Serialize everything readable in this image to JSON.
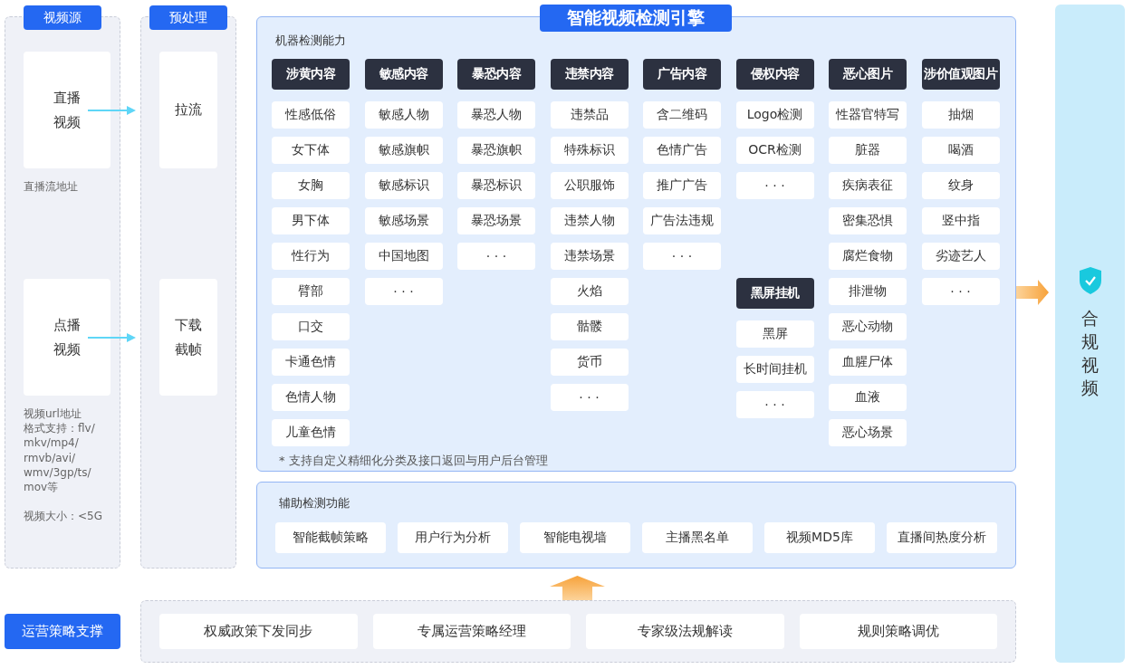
{
  "sources": {
    "title": "视频源",
    "cards": [
      {
        "label": "直播视频",
        "notes": [
          [
            "直播流地址"
          ]
        ]
      },
      {
        "label": "点播视频",
        "notes": [
          [
            "视频url地址",
            "格式支持：flv/",
            "mkv/mp4/",
            "rmvb/avi/",
            "wmv/3gp/ts/",
            "mov等"
          ],
          [
            "视频大小：<5G"
          ]
        ]
      }
    ]
  },
  "preprocess": {
    "title": "预处理",
    "cards": [
      {
        "label": "拉流"
      },
      {
        "label": "下载截帧"
      }
    ]
  },
  "engine": {
    "title": "智能视频检测引擎",
    "machine": {
      "title": "机器检测能力",
      "columns": [
        {
          "groups": [
            {
              "title": "涉黄内容",
              "items": [
                "性感低俗",
                "女下体",
                "女胸",
                "男下体",
                "性行为",
                "臂部",
                "口交",
                "卡通色情",
                "色情人物",
                "儿童色情"
              ]
            }
          ]
        },
        {
          "groups": [
            {
              "title": "敏感内容",
              "items": [
                "敏感人物",
                "敏感旗帜",
                "敏感标识",
                "敏感场景",
                "中国地图",
                "· · ·"
              ]
            }
          ]
        },
        {
          "groups": [
            {
              "title": "暴恐内容",
              "items": [
                "暴恐人物",
                "暴恐旗帜",
                "暴恐标识",
                "暴恐场景",
                "· · ·"
              ]
            }
          ]
        },
        {
          "groups": [
            {
              "title": "违禁内容",
              "items": [
                "违禁品",
                "特殊标识",
                "公职服饰",
                "违禁人物",
                "违禁场景",
                "火焰",
                "骷髅",
                "货币",
                "· · ·"
              ]
            }
          ]
        },
        {
          "groups": [
            {
              "title": "广告内容",
              "items": [
                "含二维码",
                "色情广告",
                "推广广告",
                "广告法违规",
                "· · ·"
              ]
            }
          ]
        },
        {
          "groups": [
            {
              "title": "侵权内容",
              "items": [
                "Logo检测",
                "OCR检测",
                "· · ·"
              ]
            },
            {
              "title": "黑屏挂机",
              "items": [
                "黑屏",
                "长时间挂机",
                "· · ·"
              ]
            }
          ]
        },
        {
          "groups": [
            {
              "title": "恶心图片",
              "items": [
                "性器官特写",
                "脏器",
                "疾病表征",
                "密集恐惧",
                "腐烂食物",
                "排泄物",
                "恶心动物",
                "血腥尸体",
                "血液",
                "恶心场景"
              ]
            }
          ]
        },
        {
          "groups": [
            {
              "title": "涉价值观图片",
              "items": [
                "抽烟",
                "喝酒",
                "纹身",
                "竖中指",
                "劣迹艺人",
                "· · ·"
              ]
            }
          ]
        }
      ],
      "footnote": "* 支持自定义精细化分类及接口返回与用户后台管理"
    },
    "auxiliary": {
      "title": "辅助检测功能",
      "items": [
        "智能截帧策略",
        "用户行为分析",
        "智能电视墙",
        "主播黑名单",
        "视频MD5库",
        "直播间热度分析"
      ]
    }
  },
  "operations": {
    "title": "运营策略支撑",
    "items": [
      "权威政策下发同步",
      "专属运营策略经理",
      "专家级法规解读",
      "规则策略调优"
    ]
  },
  "output": {
    "label": "合规视频"
  }
}
